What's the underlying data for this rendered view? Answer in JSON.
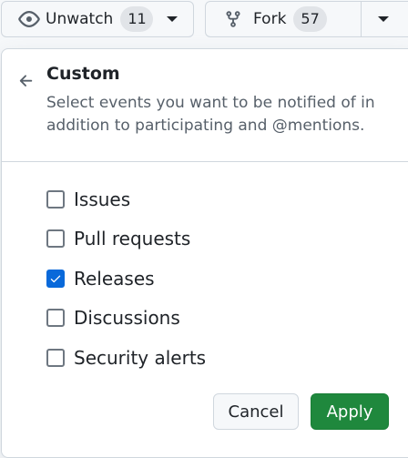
{
  "repo_actions": {
    "watch": {
      "label": "Unwatch",
      "count": "11",
      "icon": "eye-icon"
    },
    "fork": {
      "label": "Fork",
      "count": "57",
      "icon": "repo-forked-icon"
    }
  },
  "notification_panel": {
    "title": "Custom",
    "description": "Select events you want to be notified of in addition to participating and @mentions.",
    "options": [
      {
        "label": "Issues",
        "checked": false
      },
      {
        "label": "Pull requests",
        "checked": false
      },
      {
        "label": "Releases",
        "checked": true
      },
      {
        "label": "Discussions",
        "checked": false
      },
      {
        "label": "Security alerts",
        "checked": false
      }
    ],
    "cancel_label": "Cancel",
    "apply_label": "Apply"
  },
  "colors": {
    "accent_blue": "#0969da",
    "apply_green": "#1f883d",
    "border": "#d0d7de",
    "muted_text": "#57606a"
  }
}
